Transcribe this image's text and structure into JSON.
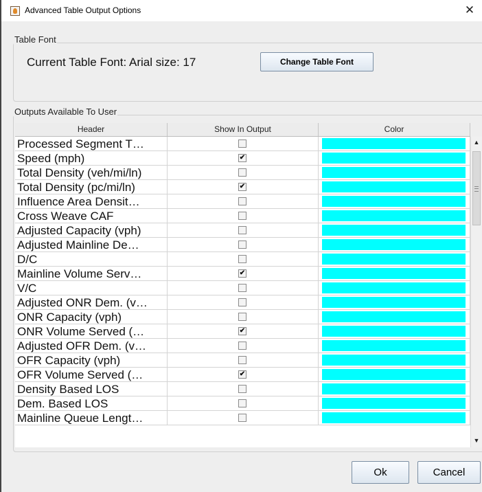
{
  "window": {
    "title": "Advanced Table Output Options",
    "close_glyph": "✕"
  },
  "table_font": {
    "group_label": "Table Font",
    "current_font_text": "Current Table Font: Arial size: 17",
    "change_button": "Change Table Font"
  },
  "outputs": {
    "group_label": "Outputs Available To User",
    "columns": [
      "Header",
      "Show In Output",
      "Color"
    ],
    "swatch_color": "#00ffff",
    "check_glyph": "✔",
    "rows": [
      {
        "header": "Processed Segment T…",
        "checked": false
      },
      {
        "header": "Speed (mph)",
        "checked": true
      },
      {
        "header": "Total Density (veh/mi/ln)",
        "checked": false
      },
      {
        "header": "Total Density (pc/mi/ln)",
        "checked": true
      },
      {
        "header": "Influence Area Densit…",
        "checked": false
      },
      {
        "header": "Cross Weave CAF",
        "checked": false
      },
      {
        "header": "Adjusted Capacity (vph)",
        "checked": false
      },
      {
        "header": "Adjusted Mainline De…",
        "checked": false
      },
      {
        "header": "D/C",
        "checked": false
      },
      {
        "header": "Mainline Volume Serv…",
        "checked": true
      },
      {
        "header": "V/C",
        "checked": false
      },
      {
        "header": "Adjusted ONR Dem. (v…",
        "checked": false
      },
      {
        "header": "ONR Capacity (vph)",
        "checked": false
      },
      {
        "header": "ONR Volume Served (…",
        "checked": true
      },
      {
        "header": "Adjusted OFR Dem. (v…",
        "checked": false
      },
      {
        "header": "OFR Capacity (vph)",
        "checked": false
      },
      {
        "header": "OFR Volume Served (…",
        "checked": true
      },
      {
        "header": "Density Based LOS",
        "checked": false
      },
      {
        "header": "Dem. Based LOS",
        "checked": false
      },
      {
        "header": "Mainline Queue Lengt…",
        "checked": false
      }
    ]
  },
  "scrollbar": {
    "up_glyph": "▲",
    "down_glyph": "▼"
  },
  "buttons": {
    "ok": "Ok",
    "cancel": "Cancel"
  }
}
